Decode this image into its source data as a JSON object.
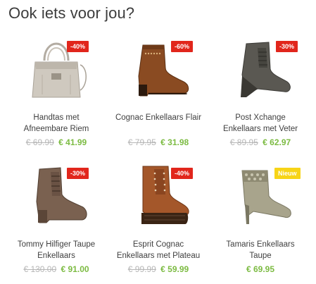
{
  "section": {
    "title": "Ook iets voor jou?"
  },
  "colors": {
    "sale_badge": "#e1261c",
    "new_badge": "#f7d417",
    "price": "#7cbb42",
    "old_price": "#b6b6b6"
  },
  "products": [
    {
      "name_line1": "Handtas met",
      "name_line2": "Afneembare Riem",
      "badge": "-40%",
      "badge_type": "sale",
      "old_price": "€ 69.99",
      "price": "€ 41.99",
      "icon": "handbag-icon"
    },
    {
      "name_line1": "Cognac Enkellaars Flair",
      "name_line2": "",
      "badge": "-60%",
      "badge_type": "sale",
      "old_price": "€ 79.95",
      "price": "€ 31.98",
      "icon": "ankle-boot-icon"
    },
    {
      "name_line1": "Post Xchange",
      "name_line2": "Enkellaars met Veter",
      "badge": "-30%",
      "badge_type": "sale",
      "old_price": "€ 89.95",
      "price": "€ 62.97",
      "icon": "wedge-boot-icon"
    },
    {
      "name_line1": "Tommy Hilfiger Taupe",
      "name_line2": "Enkellaars",
      "badge": "-30%",
      "badge_type": "sale",
      "old_price": "€ 130.00",
      "price": "€ 91.00",
      "icon": "lace-boot-icon"
    },
    {
      "name_line1": "Esprit Cognac",
      "name_line2": "Enkellaars met Plateau",
      "badge": "-40%",
      "badge_type": "sale",
      "old_price": "€ 99.99",
      "price": "€ 59.99",
      "icon": "platform-boot-icon"
    },
    {
      "name_line1": "Tamaris Enkellaars",
      "name_line2": "Taupe",
      "badge": "Nieuw",
      "badge_type": "new",
      "old_price": "",
      "price": "€ 69.95",
      "icon": "heeled-bootie-icon"
    }
  ]
}
